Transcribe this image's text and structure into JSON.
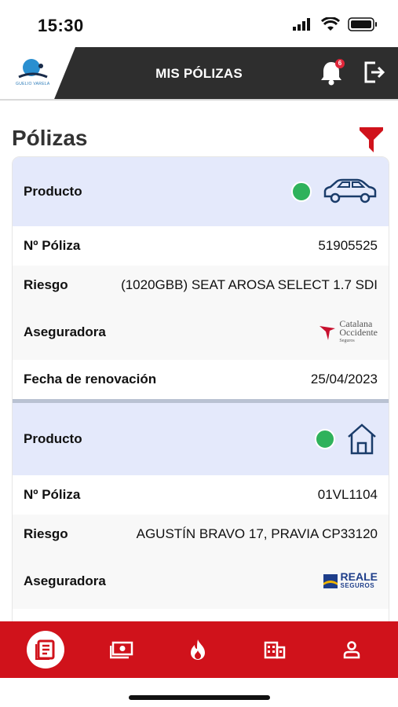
{
  "status": {
    "time": "15:30"
  },
  "header": {
    "title": "MIS PÓLIZAS",
    "notification_count": "6",
    "logo_text": "GUELIO VARELA"
  },
  "page": {
    "title": "Pólizas"
  },
  "policies": [
    {
      "product_label": "Producto",
      "product_icon": "car-icon",
      "status_color": "#2fb25b",
      "number_label": "Nº Póliza",
      "number": "51905525",
      "risk_label": "Riesgo",
      "risk": "(1020GBB) SEAT AROSA SELECT 1.7 SDI",
      "insurer_label": "Aseguradora",
      "insurer_line1": "Catalana",
      "insurer_line2": "Occidente",
      "insurer_line3": "Seguros",
      "renewal_label": "Fecha de renovación",
      "renewal": "25/04/2023"
    },
    {
      "product_label": "Producto",
      "product_icon": "house-icon",
      "status_color": "#2fb25b",
      "number_label": "Nº Póliza",
      "number": "01VL1104",
      "risk_label": "Riesgo",
      "risk": "AGUSTÍN BRAVO 17, PRAVIA CP33120",
      "insurer_label": "Aseguradora",
      "insurer_line1": "REALE",
      "insurer_line2": "SEGUROS"
    }
  ],
  "bottom_nav": [
    "policies-icon",
    "money-icon",
    "fire-icon",
    "building-icon",
    "profile-icon"
  ],
  "colors": {
    "header_bg": "#2e2e2e",
    "accent": "#d0121b",
    "product_bg": "#e4e9fb"
  }
}
